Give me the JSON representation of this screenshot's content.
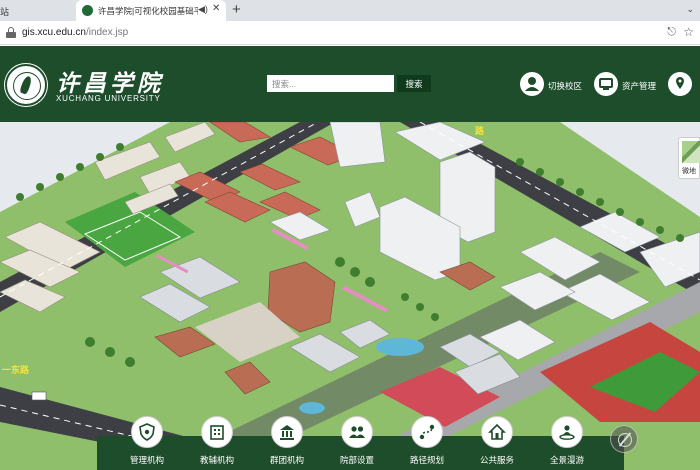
{
  "browser": {
    "left_tab_text": "站",
    "tab_title": "许昌学院|可视化校园基础平台",
    "address_host": "gis.xcu.edu.cn",
    "address_path": "/index.jsp"
  },
  "header": {
    "name_cn": "许昌学院",
    "name_en": "XUCHANG UNIVERSITY",
    "search_placeholder": "搜索...",
    "search_button": "搜索",
    "links": [
      {
        "label": "切换校区",
        "icon": "user-icon"
      },
      {
        "label": "资产管理",
        "icon": "monitor-icon"
      },
      {
        "label": "",
        "icon": "pin-icon"
      }
    ]
  },
  "map": {
    "road_labels": [
      "路",
      "一东路"
    ],
    "side_widget_label": "微地"
  },
  "bottom_nav": [
    {
      "label": "管理机构",
      "icon": "shield-icon"
    },
    {
      "label": "教辅机构",
      "icon": "building-icon"
    },
    {
      "label": "群团机构",
      "icon": "institution-icon"
    },
    {
      "label": "院部设置",
      "icon": "people-icon"
    },
    {
      "label": "路径规划",
      "icon": "route-icon"
    },
    {
      "label": "公共服务",
      "icon": "home-service-icon"
    },
    {
      "label": "全景漫游",
      "icon": "panorama-icon"
    }
  ],
  "colors": {
    "header_green": "#1e4d2b",
    "search_button": "#0f3a1c"
  }
}
